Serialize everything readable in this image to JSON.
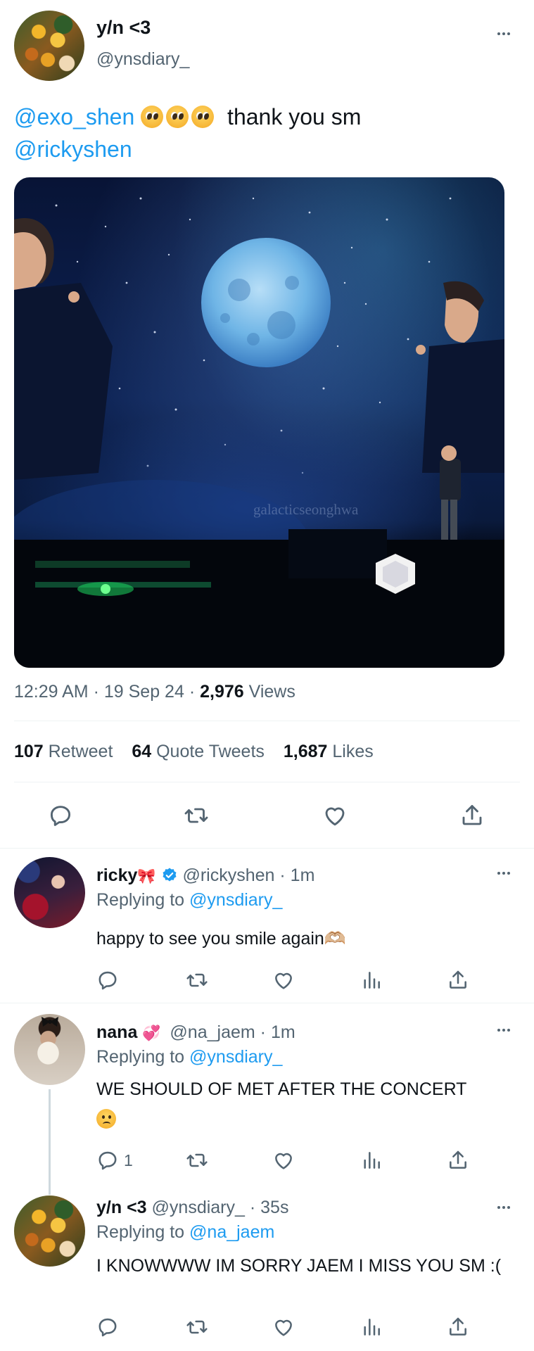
{
  "main_tweet": {
    "display_name": "y/n <3",
    "handle": "@ynsdiary_",
    "mentions": [
      "@exo_shen",
      "@rickyshen"
    ],
    "text": "thank you sm",
    "image_watermark": "galacticseonghwa",
    "time": "12:29 AM",
    "date": "19 Sep 24",
    "views_count": "2,976",
    "views_label": "Views",
    "retweets_count": "107",
    "retweets_label": "Retweet",
    "quotes_count": "64",
    "quotes_label": "Quote Tweets",
    "likes_count": "1,687",
    "likes_label": "Likes"
  },
  "replies": [
    {
      "display_name": "ricky",
      "name_emoji": "🎀",
      "verified": true,
      "handle": "@rickyshen",
      "time": "1m",
      "replying_label": "Replying to",
      "replying_to": "@ynsdiary_",
      "text": "happy to see you smile again🫶🏼",
      "reply_count": ""
    },
    {
      "display_name": "nana",
      "name_emoji": "💞",
      "verified": false,
      "handle": "@na_jaem",
      "time": "1m",
      "replying_label": "Replying to",
      "replying_to": "@ynsdiary_",
      "text": "WE SHOULD OF MET AFTER THE CONCERT",
      "reply_count": "1"
    },
    {
      "display_name": "y/n <3",
      "name_emoji": "",
      "verified": false,
      "handle": "@ynsdiary_",
      "time": "35s",
      "replying_label": "Replying to",
      "replying_to": "@na_jaem",
      "text": "I KNOWWWW IM SORRY JAEM I MISS YOU SM :(",
      "reply_count": ""
    }
  ],
  "separators": {
    "dot": "·"
  },
  "icons": [
    "more-icon",
    "reply-icon",
    "retweet-icon",
    "like-icon",
    "share-icon",
    "analytics-icon",
    "verified-badge-icon",
    "pleading-face-emoji",
    "frowning-face-emoji"
  ],
  "colors": {
    "link": "#1d9bf0",
    "muted": "#536471",
    "text": "#0f1419",
    "verified": "#1d9bf0"
  }
}
